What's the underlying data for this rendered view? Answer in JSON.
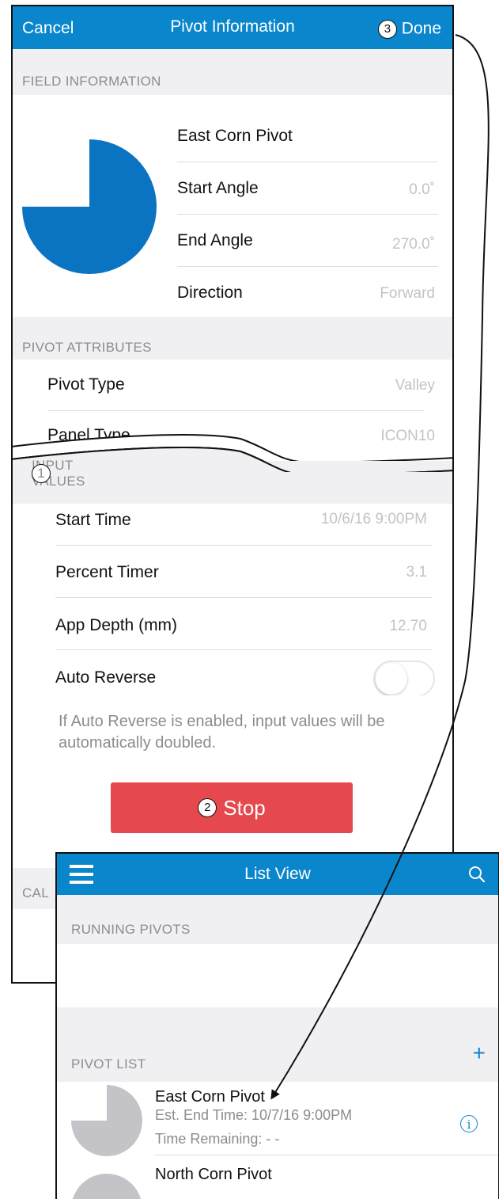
{
  "pivot_information": {
    "nav": {
      "cancel_label": "Cancel",
      "title": "Pivot Information",
      "done_callout": "3",
      "done_label": "Done"
    },
    "field_information": {
      "header": "FIELD INFORMATION",
      "pivot_name": "East Corn Pivot",
      "start_angle_label": "Start Angle",
      "start_angle_value": "0.0˚",
      "end_angle_label": "End Angle",
      "end_angle_value": "270.0˚",
      "direction_label": "Direction",
      "direction_value": "Forward",
      "coverage_fraction": 0.75,
      "pie_color": "#0a74c2"
    },
    "pivot_attributes": {
      "header": "PIVOT ATTRIBUTES",
      "pivot_type_label": "Pivot Type",
      "pivot_type_value": "Valley",
      "panel_type_label": "Panel Type",
      "panel_type_value": "ICON10"
    },
    "input_values": {
      "header": "INPUT VALUES",
      "header_callout": "1",
      "start_time_label": "Start Time",
      "start_time_value": "10/6/16  9:00PM",
      "percent_timer_label": "Percent Timer",
      "percent_timer_value": "3.1",
      "app_depth_label": "App Depth (mm)",
      "app_depth_value": "12.70",
      "auto_reverse_label": "Auto Reverse",
      "auto_reverse_on": false,
      "note": "If Auto Reverse is enabled, input values will be automatically doubled."
    },
    "stop_button": {
      "callout": "2",
      "label": "Stop",
      "color": "#e5484d"
    },
    "partial_section_header": "CAL"
  },
  "list_view": {
    "nav": {
      "title": "List View"
    },
    "running_pivots": {
      "header": "RUNNING PIVOTS"
    },
    "pivot_list": {
      "header": "PIVOT LIST",
      "add_label": "+",
      "items": [
        {
          "name": "East Corn Pivot",
          "est_end": "Est. End Time: 10/7/16  9:00PM",
          "time_remaining": "Time Remaining: - -",
          "coverage_fraction": 0.75
        },
        {
          "name": "North Corn Pivot",
          "coverage_fraction": 1.0
        }
      ]
    }
  },
  "colors": {
    "nav_blue": "#0a86cc",
    "value_gray": "#c3c3c8",
    "header_bg": "#f0f0f3"
  }
}
